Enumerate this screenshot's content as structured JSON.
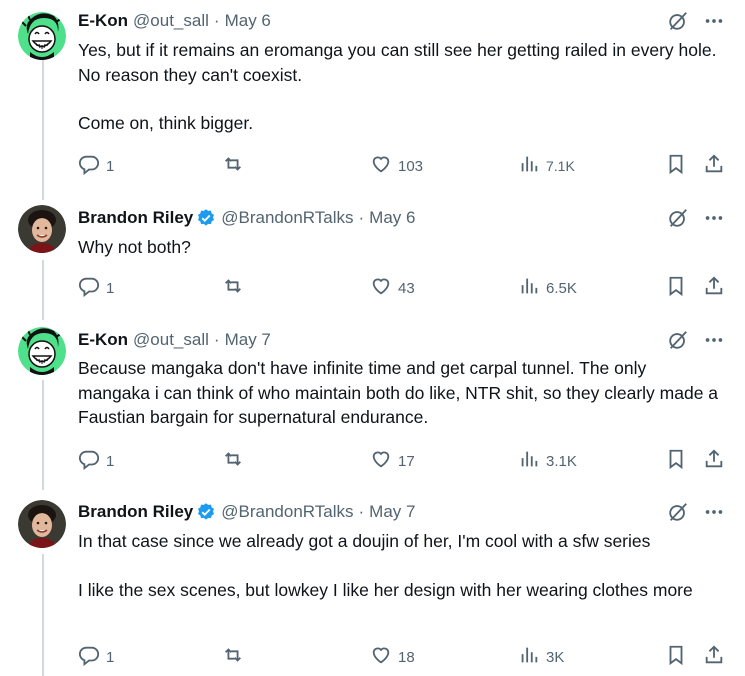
{
  "tweets": [
    {
      "name": "E-Kon",
      "handle": "@out_sall",
      "separator": "·",
      "date": "May 6",
      "verified": false,
      "avatar": "ekon-avatar",
      "paragraphs": [
        "Yes, but if it remains an eromanga you can still see her getting railed in every hole. No reason they can't coexist.",
        "Come on, think bigger."
      ],
      "replies": "1",
      "retweets": "",
      "likes": "103",
      "views": "7.1K"
    },
    {
      "name": "Brandon Riley",
      "handle": "@BrandonRTalks",
      "separator": "·",
      "date": "May 6",
      "verified": true,
      "avatar": "brandon-avatar",
      "paragraphs": [
        "Why not both?"
      ],
      "replies": "1",
      "retweets": "",
      "likes": "43",
      "views": "6.5K"
    },
    {
      "name": "E-Kon",
      "handle": "@out_sall",
      "separator": "·",
      "date": "May 7",
      "verified": false,
      "avatar": "ekon-avatar",
      "paragraphs": [
        "Because mangaka don't have infinite time and get carpal tunnel. The only mangaka i can think of who maintain both do like, NTR shit, so they clearly made a Faustian bargain for supernatural endurance."
      ],
      "replies": "1",
      "retweets": "",
      "likes": "17",
      "views": "3.1K"
    },
    {
      "name": "Brandon Riley",
      "handle": "@BrandonRTalks",
      "separator": "·",
      "date": "May 7",
      "verified": true,
      "avatar": "brandon-avatar",
      "paragraphs": [
        "In that case since we already got a doujin of her, I'm cool with a sfw series",
        "I like the sex scenes, but lowkey I like her design with her wearing clothes more"
      ],
      "replies": "1",
      "retweets": "",
      "likes": "18",
      "views": "3K"
    }
  ],
  "colors": {
    "text": "#0f1419",
    "secondary": "#536471",
    "verified": "#1d9bf0",
    "thread_line": "#cfd9de",
    "ekon_avatar_bg": "#4ee08a"
  },
  "icons": {
    "grok": "grok-icon",
    "more": "more-icon",
    "reply": "reply-icon",
    "retweet": "retweet-icon",
    "like": "like-icon",
    "views": "views-icon",
    "bookmark": "bookmark-icon",
    "share": "share-icon",
    "verified": "verified-badge-icon"
  }
}
